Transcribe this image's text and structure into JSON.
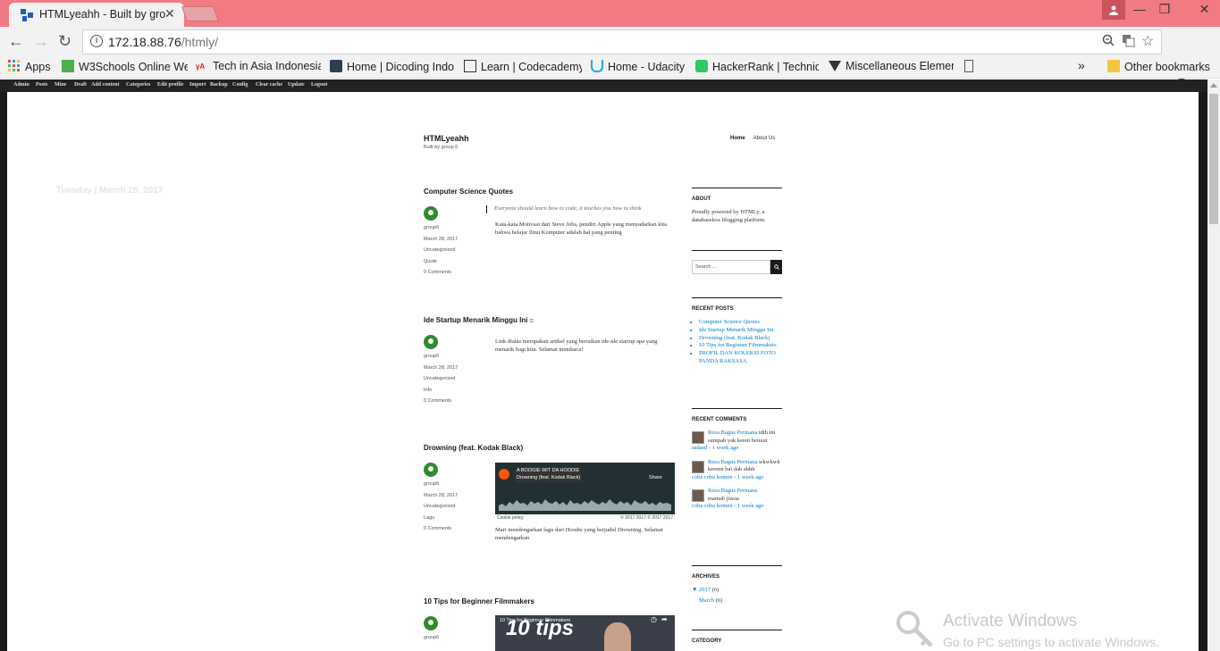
{
  "browser": {
    "tab_title": "HTMLyeahh - Built by gro",
    "url_host": "172.18.88.76",
    "url_path": "/htmly/"
  },
  "bookmarks": {
    "apps": "Apps",
    "items": [
      "W3Schools Online We",
      "Tech in Asia Indonesia",
      "Home | Dicoding Indo",
      "Learn | Codecademy",
      "Home - Udacity",
      "HackerRank | Technica",
      "Miscellaneous Elemen"
    ],
    "more": "»",
    "other": "Other bookmarks"
  },
  "admin_bar": [
    "Admin",
    "Posts",
    "Mine",
    "Draft",
    "Add content",
    "Categories",
    "Edit profile",
    "Import",
    "Backup",
    "Config",
    "Clear cache",
    "Update",
    "Logout"
  ],
  "side_date": "Tuesday | March 28, 2017",
  "site": {
    "title": "HTMLyeahh",
    "description": "Built by group 6",
    "nav": [
      "Home",
      "About Us"
    ]
  },
  "posts": [
    {
      "title": "Computer Science Quotes",
      "meta": [
        "group6",
        "March 28, 2017",
        "Uncategorized",
        "Quote",
        "0 Comments"
      ],
      "quote": "Everyone should learn how to code, it teaches you how to think",
      "text": "Kata-kata Motivasi dari Steve Jobs, pendiri Apple yang menyadarkan kita bahwa belajar Ilmu Komputer adalah hal yang penting"
    },
    {
      "title": "Ide Startup Menarik Minggu Ini",
      "meta": [
        "group6",
        "March 28, 2017",
        "Uncategorized",
        "Info",
        "0 Comments"
      ],
      "text": "Link diatas merupakan artikel yang berisikan ide-ide startup apa yang menarik bagi kita. Selamat membaca!"
    },
    {
      "title": "Drowning (feat. Kodak Black)",
      "meta": [
        "group6",
        "March 28, 2017",
        "Uncategorized",
        "Lagu",
        "0 Comments"
      ],
      "embed_artist": "A BOOGIE WIT DA HOODIE",
      "embed_track": "Drowning (feat. Kodak Black)",
      "embed_share": "Share",
      "embed_cookie": "Cookie policy",
      "embed_copy": "© 2017 2017 © 2017 2017",
      "text": "Mari mendengarkan lagu dari Hoodie yang berjudul Drowning. Selamat mendengarkan"
    },
    {
      "title": "10 Tips for Beginner Filmmakers",
      "meta": [
        "group6"
      ],
      "video_title": "10 Tips for Beginner Filmmakers",
      "video_big": "10 tips"
    }
  ],
  "sidebar": {
    "about_h": "ABOUT",
    "about_txt": "Proudly powered by HTMLy, a databaseless blogging platform.",
    "search_placeholder": "Search ...",
    "recent_posts_h": "RECENT POSTS",
    "recent_posts": [
      "Computer Science Quotes",
      "Ide Startup Menarik Minggu Ini",
      "Drowning (feat. Kodak Black)",
      "10 Tips for Beginner Filmmakers",
      "PROFIL DAN KOLEKSI FOTO PANDA RAKSASA"
    ],
    "recent_comments_h": "RECENT COMMENTS",
    "comments": [
      {
        "author": "Reza Bagus Permana",
        "text": "idih ini sumpah yak keren beuuut",
        "where": "sadasd - 1 week ago"
      },
      {
        "author": "Reza Bagus Permana",
        "text": "wkwkwk kerenn bat dah ahhh",
        "where": "coba coba komen - 1 week ago"
      },
      {
        "author": "Reza Bagus Permana",
        "text": "mantab jiwaa",
        "where": "coba coba komen - 1 week ago"
      }
    ],
    "archives_h": "ARCHIVES",
    "archive_year": "▼ 2017",
    "archive_year_count": "(6)",
    "archive_month": "March",
    "archive_month_count": "(6)",
    "category_h": "CATEGORY"
  },
  "watermark": {
    "line1": "Activate Windows",
    "line2": "Go to PC settings to activate Windows."
  }
}
